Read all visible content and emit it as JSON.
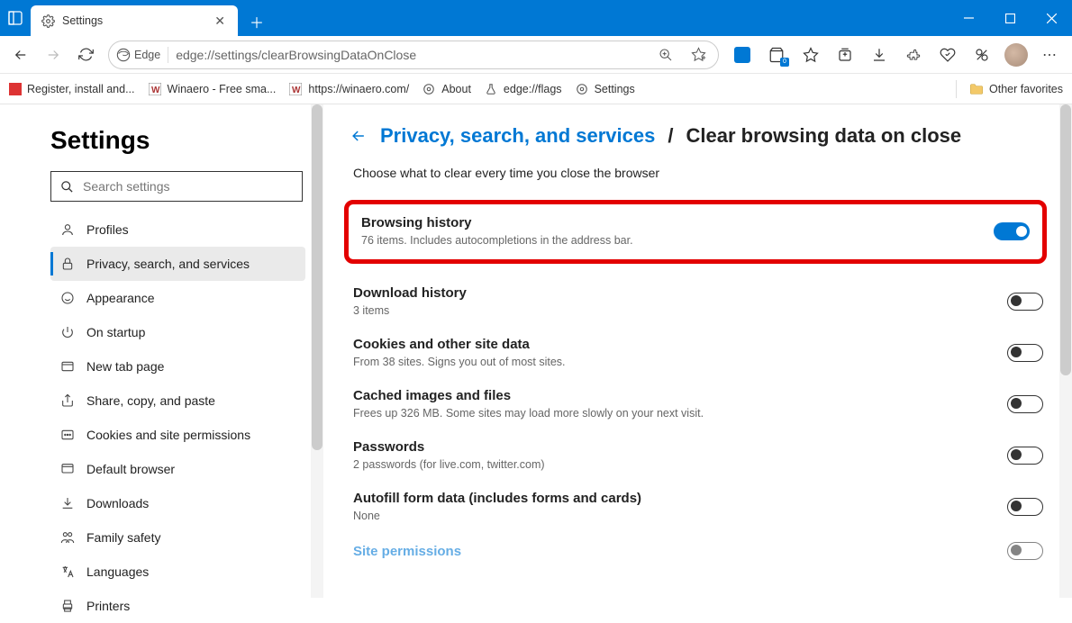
{
  "window": {
    "tab_title": "Settings"
  },
  "addressbar": {
    "browser_label": "Edge",
    "url": "edge://settings/clearBrowsingDataOnClose"
  },
  "bookmarks": {
    "items": [
      {
        "label": "Register, install and..."
      },
      {
        "label": "Winaero - Free sma..."
      },
      {
        "label": "https://winaero.com/"
      },
      {
        "label": "About"
      },
      {
        "label": "edge://flags"
      },
      {
        "label": "Settings"
      }
    ],
    "other": "Other favorites"
  },
  "sidebar": {
    "title": "Settings",
    "search_placeholder": "Search settings",
    "items": [
      {
        "label": "Profiles"
      },
      {
        "label": "Privacy, search, and services"
      },
      {
        "label": "Appearance"
      },
      {
        "label": "On startup"
      },
      {
        "label": "New tab page"
      },
      {
        "label": "Share, copy, and paste"
      },
      {
        "label": "Cookies and site permissions"
      },
      {
        "label": "Default browser"
      },
      {
        "label": "Downloads"
      },
      {
        "label": "Family safety"
      },
      {
        "label": "Languages"
      },
      {
        "label": "Printers"
      }
    ]
  },
  "main": {
    "breadcrumb_link": "Privacy, search, and services",
    "breadcrumb_current": "Clear browsing data on close",
    "subtitle": "Choose what to clear every time you close the browser",
    "options": [
      {
        "title": "Browsing history",
        "sub": "76 items. Includes autocompletions in the address bar.",
        "on": true
      },
      {
        "title": "Download history",
        "sub": "3 items",
        "on": false
      },
      {
        "title": "Cookies and other site data",
        "sub": "From 38 sites. Signs you out of most sites.",
        "on": false
      },
      {
        "title": "Cached images and files",
        "sub": "Frees up 326 MB. Some sites may load more slowly on your next visit.",
        "on": false
      },
      {
        "title": "Passwords",
        "sub": "2 passwords (for live.com, twitter.com)",
        "on": false
      },
      {
        "title": "Autofill form data (includes forms and cards)",
        "sub": "None",
        "on": false
      },
      {
        "title": "Site permissions",
        "sub": "",
        "on": false
      }
    ]
  }
}
